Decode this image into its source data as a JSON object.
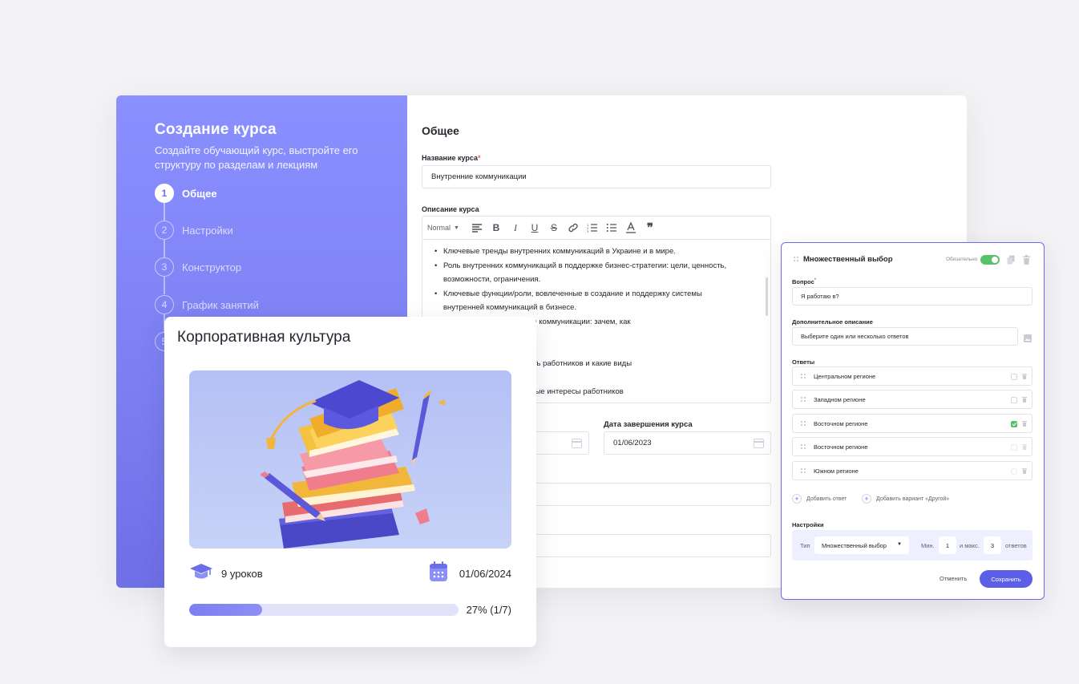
{
  "wizard": {
    "title": "Создание курса",
    "subtitle": "Создайте обучающий курс, выстройте его структуру по разделам и лекциям",
    "steps": [
      {
        "num": "1",
        "label": "Общее"
      },
      {
        "num": "2",
        "label": "Настройки"
      },
      {
        "num": "3",
        "label": "Конструктор"
      },
      {
        "num": "4",
        "label": "График занятий"
      },
      {
        "num": "5",
        "label": ""
      }
    ]
  },
  "general": {
    "title": "Общее",
    "name_label": "Название курса",
    "name_value": "Внутренние коммуникации",
    "desc_label": "Описание курса",
    "editor_format": "Normal",
    "desc_lines": [
      {
        "text": "Ключевые тренды внутренних коммуникаций в Украине и в мире.",
        "bullet": true
      },
      {
        "text": "Роль внутренних коммуникаций в поддержке бизнес-стратегии: цели, ценность,",
        "bullet": true
      },
      {
        "text": "возможности, ограничения.",
        "bullet": false
      },
      {
        "text": "Ключевые функции/роли, вовлеченные в создание и поддержку системы",
        "bullet": true
      },
      {
        "text": "внутренней коммуникаций в бизнесе.",
        "bullet": false
      },
      {
        "text": "нностей через внутренние коммуникации: зачем, как",
        "bullet": false
      },
      {
        "text": "?",
        "bullet": false
      },
      {
        "text": "ботают»?",
        "bullet": false
      },
      {
        "text": "и влияют на вовлеченность работников и какие виды",
        "bullet": false
      },
      {
        "text": "уют.",
        "bullet": false
      },
      {
        "text": "акт: совпадают ли реальные интересы работников",
        "bullet": false
      }
    ],
    "end_date_label": "Дата завершения курса",
    "end_date_value": "01/06/2023"
  },
  "course_card": {
    "title": "Корпоративная культура",
    "lessons": "9 уроков",
    "date": "01/06/2024",
    "progress_percent": 27,
    "progress_text": "27% (1/7)"
  },
  "question": {
    "type": "Множественный выбор",
    "required_label": "Обязательно",
    "question_label": "Вопрос",
    "question_value": "Я работаю в?",
    "extra_label": "Дополнительное описание",
    "extra_value": "Выберите один или несколько ответов",
    "answers_label": "Ответы",
    "answers": [
      {
        "text": "Центральном регионе",
        "checked": false
      },
      {
        "text": "Западном регионе",
        "checked": false
      },
      {
        "text": "Восточном регионе",
        "checked": true
      },
      {
        "text": "Восточном регионе",
        "checked": false
      },
      {
        "text": "Южном регионе",
        "checked": false
      }
    ],
    "add_answer": "Добавить ответ",
    "add_other": "Добавить вариант «Другой»",
    "settings_label": "Настройки",
    "type_label": "Тип",
    "type_value": "Множественный выбор",
    "min_label": "Мин.",
    "min_value": "1",
    "max_label": "и макс.",
    "max_value": "3",
    "answers_suffix": "ответов",
    "cancel": "Отменить",
    "save": "Сохранить"
  },
  "colors": {
    "accent": "#6b6ee8",
    "sidebar": "#8a90ff",
    "success": "#58c26b",
    "required": "#f05a5a"
  }
}
